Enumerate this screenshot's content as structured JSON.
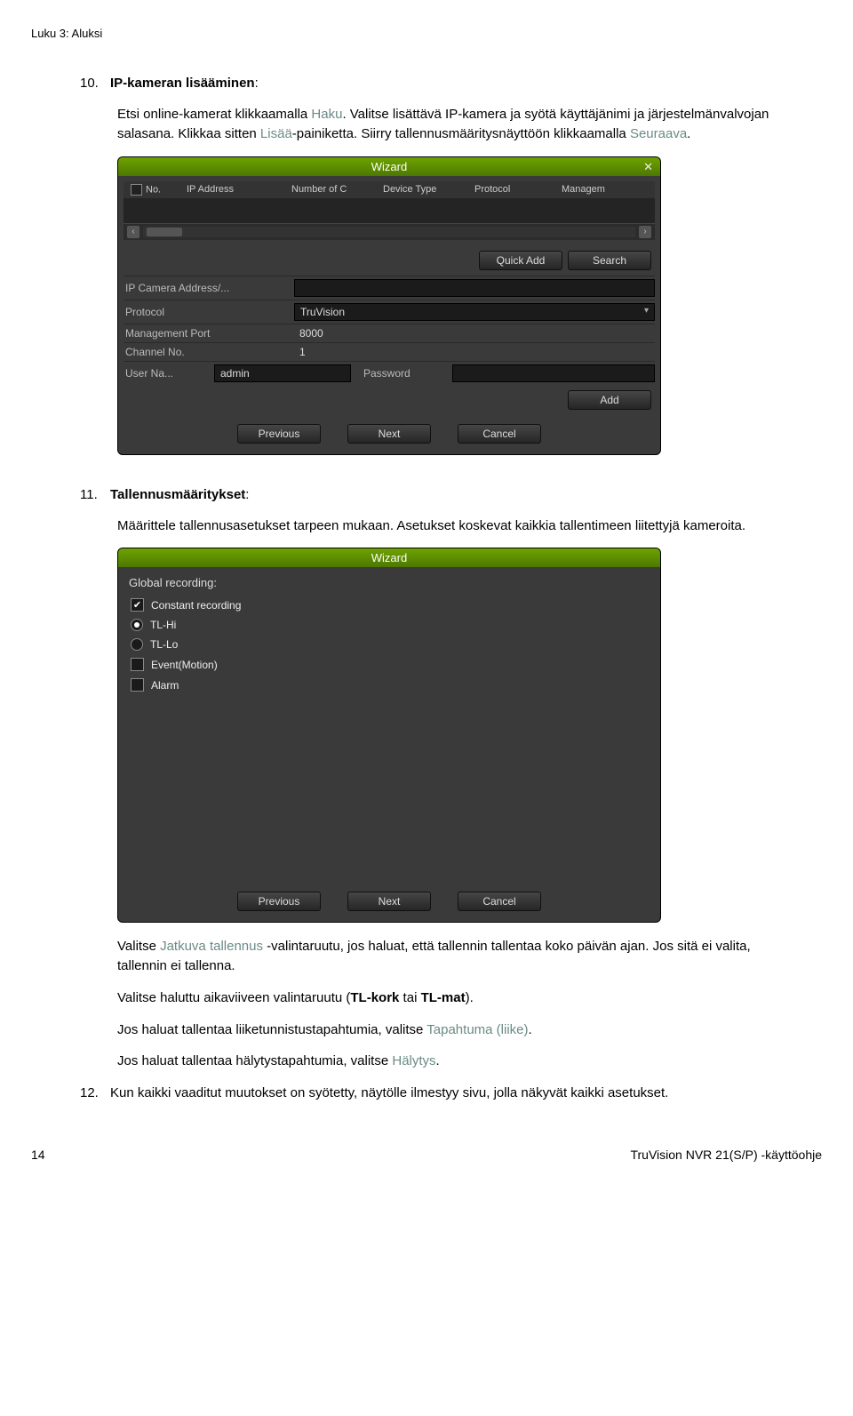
{
  "breadcrumb": "Luku 3: Aluksi",
  "item10": {
    "num": "10.",
    "title_span": "IP-kameran lisääminen",
    "title_after": ":",
    "p1": {
      "pre1": "Etsi online-kamerat klikkaamalla ",
      "haku": "Haku",
      "post1": ". Valitse lisättävä IP-kamera ja syötä käyttäjänimi ja järjestelmänvalvojan salasana. Klikkaa sitten ",
      "lisaa": "Lisää",
      "post2": "-painiketta. Siirry tallennusmääritysnäyttöön klikkaamalla ",
      "seur": "Seuraava",
      "post3": "."
    }
  },
  "panel1": {
    "wizard": "Wizard",
    "headers": {
      "no": "No.",
      "ip": "IP Address",
      "num": "Number of C",
      "dev": "Device Type",
      "prot": "Protocol",
      "man": "Managem"
    },
    "quickadd": "Quick Add",
    "search": "Search",
    "rows": {
      "addr_label": "IP Camera Address/...",
      "proto_label": "Protocol",
      "proto_val": "TruVision",
      "mgmt_label": "Management Port",
      "mgmt_val": "8000",
      "chan_label": "Channel No.",
      "chan_val": "1",
      "user_label": "User Na...",
      "user_val": "admin",
      "pass_label": "Password"
    },
    "add": "Add",
    "prev": "Previous",
    "next": "Next",
    "cancel": "Cancel"
  },
  "item11": {
    "num": "11.",
    "title_span": "Tallennusmääritykset",
    "title_after": ":",
    "p": "Määrittele tallennusasetukset tarpeen mukaan. Asetukset koskevat kaikkia tallentimeen liitettyjä kameroita."
  },
  "panel2": {
    "wizard": "Wizard",
    "global": "Global recording:",
    "opts": {
      "constant": "Constant recording",
      "tlhi": "TL-Hi",
      "tllo": "TL-Lo",
      "event": "Event(Motion)",
      "alarm": "Alarm"
    },
    "prev": "Previous",
    "next": "Next",
    "cancel": "Cancel"
  },
  "after": {
    "p1_pre": "Valitse ",
    "p1_link": "Jatkuva tallennus",
    "p1_post": " -valintaruutu, jos haluat, että tallennin tallentaa koko päivän ajan. Jos sitä ei valita, tallennin ei tallenna.",
    "p2_pre": "Valitse haluttu aikaviiveen valintaruutu (",
    "p2_b1": "TL-kork",
    "p2_mid": " tai ",
    "p2_b2": "TL-mat",
    "p2_post": ").",
    "p3_pre": "Jos haluat tallentaa liiketunnistustapahtumia, valitse ",
    "p3_link": "Tapahtuma (liike)",
    "p3_post": ".",
    "p4_pre": "Jos haluat tallentaa hälytystapahtumia, valitse ",
    "p4_link": "Hälytys",
    "p4_post": "."
  },
  "item12": {
    "num": "12.",
    "p": "Kun kaikki vaaditut muutokset on syötetty, näytölle ilmestyy sivu, jolla näkyvät kaikki asetukset."
  },
  "footer": {
    "page": "14",
    "doc": "TruVision NVR 21(S/P) -käyttöohje"
  }
}
